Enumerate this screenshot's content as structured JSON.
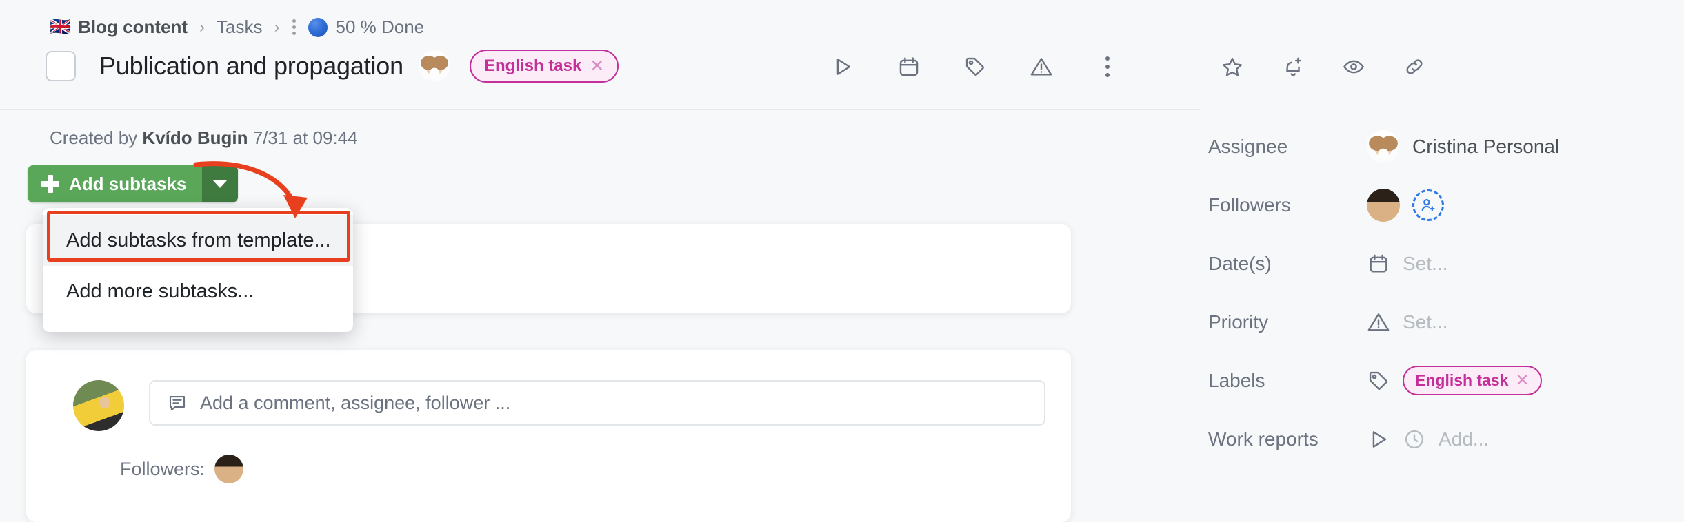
{
  "breadcrumb": {
    "flag": "🇬🇧",
    "project": "Blog content",
    "separator": "›",
    "section": "Tasks",
    "status": "50 % Done",
    "status_color": "#2f6fd8"
  },
  "task": {
    "title": "Publication and propagation",
    "label_chip": "English task",
    "chip_close": "✕",
    "chip_color": "#c4309a",
    "created_prefix": "Created by",
    "created_author": "Kvído Bugin",
    "created_date": "7/31 at 09:44"
  },
  "header_tools": [
    {
      "name": "start-timer-icon",
      "icon": "play"
    },
    {
      "name": "due-date-icon",
      "icon": "calendar"
    },
    {
      "name": "label-icon",
      "icon": "tag"
    },
    {
      "name": "priority-icon",
      "icon": "warning"
    },
    {
      "name": "more-options-icon",
      "icon": "kebab"
    }
  ],
  "subtasks": {
    "button_label": "Add subtasks",
    "button_color": "#5aa75a",
    "toggle_color": "#3f7a3f",
    "menu": [
      {
        "label": "Add subtasks from template...",
        "highlighted": true
      },
      {
        "label": "Add more subtasks...",
        "highlighted": false
      }
    ],
    "annotation_color": "#e8401f"
  },
  "comment": {
    "placeholder": "Add a comment, assignee, follower ...",
    "followers_label": "Followers:"
  },
  "side_tools": [
    {
      "name": "favorite-star-icon",
      "icon": "star"
    },
    {
      "name": "reminder-bell-icon",
      "icon": "bell-plus"
    },
    {
      "name": "watch-eye-icon",
      "icon": "eye"
    },
    {
      "name": "copy-link-icon",
      "icon": "link"
    }
  ],
  "details": {
    "assignee": {
      "label": "Assignee",
      "value": "Cristina Personal"
    },
    "followers": {
      "label": "Followers",
      "add_hint": "add-person"
    },
    "dates": {
      "label": "Date(s)",
      "value": "Set...",
      "icon": "calendar"
    },
    "priority": {
      "label": "Priority",
      "value": "Set...",
      "icon": "warning"
    },
    "labels": {
      "label": "Labels",
      "chip": "English task",
      "chip_close": "✕",
      "icon": "tag"
    },
    "work_reports": {
      "label": "Work reports",
      "value": "Add...",
      "icon": "play",
      "icon2": "clock"
    }
  }
}
